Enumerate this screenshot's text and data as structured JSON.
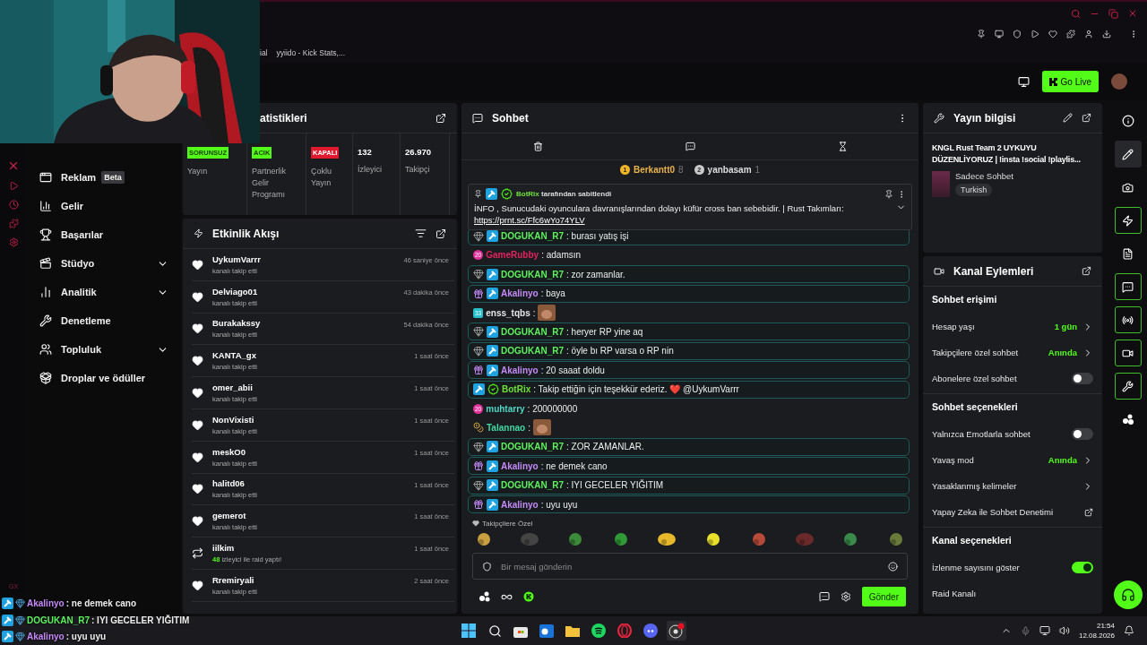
{
  "browser": {
    "bookmarks": [
      {
        "label": "ial"
      },
      {
        "label": "yyiido - Kick Stats,..."
      }
    ],
    "rail_badge": "GX"
  },
  "header": {
    "go_live": "Go Live"
  },
  "nav": [
    {
      "label": "Reklam",
      "kind": "ad",
      "badge": "Beta",
      "expandable": false
    },
    {
      "label": "Gelir",
      "kind": "revenue",
      "expandable": false
    },
    {
      "label": "Başarılar",
      "kind": "trophy",
      "expandable": false
    },
    {
      "label": "Stüdyo",
      "kind": "studio",
      "expandable": true
    },
    {
      "label": "Analitik",
      "kind": "analytics",
      "expandable": true
    },
    {
      "label": "Denetleme",
      "kind": "wrench",
      "expandable": false
    },
    {
      "label": "Topluluk",
      "kind": "community",
      "expandable": true
    },
    {
      "label": "Droplar ve ödüller",
      "kind": "drops",
      "expandable": false
    }
  ],
  "stats": {
    "title": "atistikleri",
    "cells": [
      {
        "kind": "status",
        "badge": "SORUNSUZ",
        "on": true,
        "label": "Yayın"
      },
      {
        "kind": "status",
        "badge": "ACIK",
        "on": true,
        "label": "Partnerlik Gelir Programı"
      },
      {
        "kind": "status",
        "badge": "KAPALI",
        "on": false,
        "label": "Çoklu Yayın"
      },
      {
        "kind": "number",
        "value": "132",
        "label": "İzleyici"
      },
      {
        "kind": "number",
        "value": "26.970",
        "label": "Takipçi"
      }
    ]
  },
  "activity": {
    "title": "Etkinlik Akışı",
    "items": [
      {
        "kind": "follow",
        "name": "UykumVarrr",
        "desc": "kanalı takip etti",
        "time": "46 saniye önce"
      },
      {
        "kind": "follow",
        "name": "Delviago01",
        "desc": "kanalı takip etti",
        "time": "43 dakika önce"
      },
      {
        "kind": "follow",
        "name": "Burakakssy",
        "desc": "kanalı takip etti",
        "time": "54 dakika önce"
      },
      {
        "kind": "follow",
        "name": "KANTA_gx",
        "desc": "kanalı takip etti",
        "time": "1 saat önce"
      },
      {
        "kind": "follow",
        "name": "omer_abii",
        "desc": "kanalı takip etti",
        "time": "1 saat önce"
      },
      {
        "kind": "follow",
        "name": "NonVixisti",
        "desc": "kanalı takip etti",
        "time": "1 saat önce"
      },
      {
        "kind": "follow",
        "name": "meskO0",
        "desc": "kanalı takip etti",
        "time": "1 saat önce"
      },
      {
        "kind": "follow",
        "name": "halitd06",
        "desc": "kanalı takip etti",
        "time": "1 saat önce"
      },
      {
        "kind": "follow",
        "name": "gemerot",
        "desc": "kanalı takip etti",
        "time": "1 saat önce"
      },
      {
        "kind": "raid",
        "name": "iilkim",
        "count": "48",
        "desc": "izleyici ile raid yaptı!",
        "time": "1 saat önce"
      },
      {
        "kind": "follow",
        "name": "Rremiryali",
        "desc": "kanalı takip etti",
        "time": "2 saat önce"
      }
    ]
  },
  "chat": {
    "title": "Sohbet",
    "top_chatters": [
      {
        "rank": "1",
        "name": "Berkantt0",
        "count": "8",
        "color": "#f0b429"
      },
      {
        "rank": "2",
        "name": "yanbasam",
        "count": "1",
        "color": "#c9c9c9"
      }
    ],
    "pinned": {
      "by": "BotRix",
      "by_suffix": "tarafından sabitlendi",
      "text": "İNFO , Sunucudaki oyunculara davranışlarından dolayı küfür cross ban sebebidir. | Rust Takımları:",
      "link": "https://prnt.sc/Ffc6wYo74YLV"
    },
    "messages": [
      {
        "name": "DOGUKAN_R7",
        "color": "#5ef05e",
        "text": ": burası yatış işi",
        "highlighted": true,
        "badges": [
          {
            "kind": "gem"
          },
          {
            "kind": "mod"
          }
        ]
      },
      {
        "name": "GameRubby",
        "color": "#e0245e",
        "text": ": adamsın",
        "highlighted": false,
        "badges": [
          {
            "kind": "sub",
            "text": "20"
          }
        ]
      },
      {
        "name": "DOGUKAN_R7",
        "color": "#5ef05e",
        "text": ": zor zamanlar.",
        "highlighted": true,
        "badges": [
          {
            "kind": "gem"
          },
          {
            "kind": "mod"
          }
        ]
      },
      {
        "name": "Akalinyo",
        "color": "#c58af9",
        "text": ": baya",
        "highlighted": true,
        "badges": [
          {
            "kind": "gift"
          },
          {
            "kind": "mod"
          }
        ]
      },
      {
        "name": "enss_tqbs",
        "color": "#e6e6e6",
        "text": ":",
        "highlighted": false,
        "emote": true,
        "badges": [
          {
            "kind": "level",
            "text": "33"
          }
        ]
      },
      {
        "name": "DOGUKAN_R7",
        "color": "#5ef05e",
        "text": ": heryer RP yine aq",
        "highlighted": true,
        "badges": [
          {
            "kind": "gem"
          },
          {
            "kind": "mod"
          }
        ]
      },
      {
        "name": "DOGUKAN_R7",
        "color": "#5ef05e",
        "text": ": öyle bı RP varsa o RP nin",
        "highlighted": true,
        "badges": [
          {
            "kind": "gem"
          },
          {
            "kind": "mod"
          }
        ]
      },
      {
        "name": "Akalinyo",
        "color": "#c58af9",
        "text": ": 20 saaat doldu",
        "highlighted": true,
        "badges": [
          {
            "kind": "gift"
          },
          {
            "kind": "mod"
          }
        ]
      },
      {
        "name": "BotRix",
        "color": "#6fe03a",
        "text": ": Takip ettiğin için teşekkür ederiz. ❤️ @UykumVarrr",
        "highlighted": true,
        "badges": [
          {
            "kind": "mod"
          },
          {
            "kind": "verified"
          }
        ]
      },
      {
        "name": "muhtarry",
        "color": "#4fd6c4",
        "text": ": 200000000",
        "highlighted": false,
        "badges": [
          {
            "kind": "sub",
            "text": "20"
          }
        ]
      },
      {
        "name": "Talannao",
        "color": "#3fd8a0",
        "text": ":",
        "highlighted": false,
        "emote": true,
        "badges": [
          {
            "kind": "coin"
          }
        ]
      },
      {
        "name": "DOGUKAN_R7",
        "color": "#5ef05e",
        "text": ": ZOR ZAMANLAR.",
        "highlighted": true,
        "badges": [
          {
            "kind": "gem"
          },
          {
            "kind": "mod"
          }
        ]
      },
      {
        "name": "Akalinyo",
        "color": "#c58af9",
        "text": ": ne demek cano",
        "highlighted": true,
        "badges": [
          {
            "kind": "gift"
          },
          {
            "kind": "mod"
          }
        ]
      },
      {
        "name": "DOGUKAN_R7",
        "color": "#5ef05e",
        "text": ": IYI GECELER YIĞITIM",
        "highlighted": true,
        "badges": [
          {
            "kind": "gem"
          },
          {
            "kind": "mod"
          }
        ]
      },
      {
        "name": "Akalinyo",
        "color": "#c58af9",
        "text": ": uyu uyu",
        "highlighted": true,
        "badges": [
          {
            "kind": "gift"
          },
          {
            "kind": "mod"
          }
        ]
      }
    ],
    "emote_section": "Takipçilere Özel",
    "placeholder": "Bir mesaj gönderin",
    "send": "Gönder"
  },
  "stream_info": {
    "title": "Yayın bilgisi",
    "stream_title": "KNGL Rust Team 2 UYKUYU DÜZENLİYORUZ | !insta !social !playlis...",
    "category": "Sadece Sohbet",
    "tag": "Turkish"
  },
  "channel_actions": {
    "title": "Kanal Eylemleri",
    "sections": [
      {
        "title": "Sohbet erişimi",
        "rows": [
          {
            "kind": "link",
            "label": "Hesap yaşı",
            "value": "1 gün"
          },
          {
            "kind": "link",
            "label": "Takipçilere özel sohbet",
            "value": "Anında"
          },
          {
            "kind": "toggle",
            "label": "Abonelere özel sohbet",
            "on": false
          }
        ]
      },
      {
        "title": "Sohbet seçenekleri",
        "rows": [
          {
            "kind": "toggle",
            "label": "Yalnızca Emotlarla sohbet",
            "on": false
          },
          {
            "kind": "link",
            "label": "Yavaş mod",
            "value": "Anında"
          },
          {
            "kind": "link",
            "label": "Yasaklanmış kelimeler"
          },
          {
            "kind": "external",
            "label": "Yapay Zeka ile Sohbet Denetimi"
          }
        ]
      },
      {
        "title": "Kanal seçenekleri",
        "rows": [
          {
            "kind": "toggle",
            "label": "İzlenme sayısını göster",
            "on": true
          },
          {
            "kind": "plain",
            "label": "Raid Kanalı"
          }
        ]
      }
    ]
  },
  "rail": [
    {
      "kind": "info",
      "selected": false,
      "active": false
    },
    {
      "kind": "edit",
      "selected": true,
      "active": false
    },
    {
      "kind": "camera",
      "selected": false,
      "active": false
    },
    {
      "kind": "bolt",
      "selected": false,
      "active": true
    },
    {
      "kind": "notes",
      "selected": false,
      "active": false
    },
    {
      "kind": "chat",
      "selected": false,
      "active": true
    },
    {
      "kind": "broadcast",
      "selected": false,
      "active": true
    },
    {
      "kind": "video",
      "selected": false,
      "active": true
    },
    {
      "kind": "wrench",
      "selected": false,
      "active": true
    },
    {
      "kind": "dots",
      "selected": false,
      "active": false
    }
  ],
  "stream_overlay": [
    {
      "name": "Akalinyo",
      "color": "#c58af9",
      "text": ": ne demek cano"
    },
    {
      "name": "DOGUKAN_R7",
      "color": "#5ef05e",
      "text": ": IYI GECELER YIĞITIM"
    },
    {
      "name": "Akalinyo",
      "color": "#c58af9",
      "text": ": uyu uyu"
    }
  ],
  "taskbar": {
    "time": "21:54",
    "date": "12.08.2026"
  }
}
